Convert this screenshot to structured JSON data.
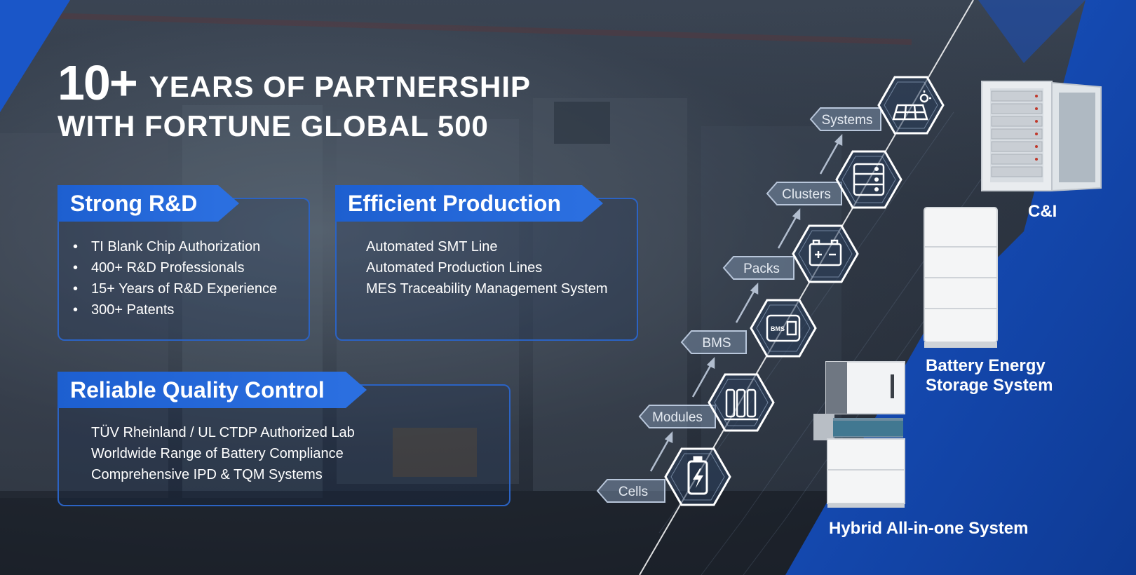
{
  "headline": {
    "number": "10+",
    "line1": "YEARS OF PARTNERSHIP",
    "line2": "WITH FORTUNE GLOBAL 500"
  },
  "panels": {
    "rd": {
      "title": "Strong R&D",
      "items": [
        "TI Blank Chip Authorization",
        "400+ R&D Professionals",
        "15+ Years of R&D Experience",
        "300+ Patents"
      ]
    },
    "production": {
      "title": "Efficient Production",
      "items": [
        "Automated SMT Line",
        "Automated Production Lines",
        "MES Traceability Management System"
      ]
    },
    "quality": {
      "title": "Reliable Quality Control",
      "items": [
        "TÜV Rheinland / UL CTDP Authorized Lab",
        "Worldwide Range of Battery Compliance",
        "Comprehensive IPD & TQM Systems"
      ]
    }
  },
  "stages": [
    "Cells",
    "Modules",
    "BMS",
    "Packs",
    "Clusters",
    "Systems"
  ],
  "stage_icons": [
    "battery-bolt-icon",
    "cylindrical-cells-icon",
    "bms-board-icon",
    "battery-pack-icon",
    "server-rack-icon",
    "solar-panel-icon"
  ],
  "products": {
    "ci": "C&I",
    "bess_line1": "Battery Energy",
    "bess_line2": "Storage System",
    "hybrid": "Hybrid All-in-one System"
  },
  "colors": {
    "accent": "#1d5fd0",
    "panel_border": "#2b63c4",
    "right_blue": "#1447a8"
  }
}
